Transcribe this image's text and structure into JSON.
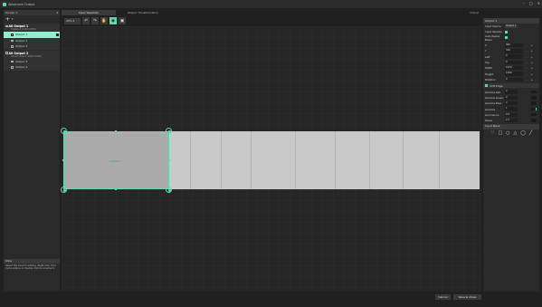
{
  "window": {
    "title": "Advanced Output",
    "controls": [
      "–",
      "□",
      "✕"
    ]
  },
  "left_panel": {
    "screen_label": "Screen 1",
    "add_icon": "+",
    "add_arrow": "▾",
    "groups": [
      {
        "name": "All Output 1",
        "sub": "Display 2 (1920×1080)",
        "outputs": [
          "Output 1",
          "Output 2",
          "Output 3"
        ],
        "selected": 0
      },
      {
        "name": "All Output 2",
        "sub": "Virtual Output (1920×1080)",
        "outputs": [
          "Output 3",
          "Output 4"
        ],
        "selected": -1
      }
    ]
  },
  "info": {
    "title": "Slice",
    "text": "Select the slice for editing. Right click it for more options or double click to rename it."
  },
  "tabs": {
    "input": "Input Selection",
    "output": "Output Transformation",
    "corner": "Virtual"
  },
  "toolbar": {
    "zoom": "29%",
    "zoom_arrow": "▾"
  },
  "canvas": {
    "selected_label": "Output 1",
    "columns": 8
  },
  "right_panel": {
    "title": "Output 1",
    "input_source_label": "Input Source",
    "input_source_value": "Output 1",
    "rows_check": [
      "Input Opacity",
      "Auto Resize Bezel"
    ],
    "numeric": [
      {
        "label": "X",
        "value": "960"
      },
      {
        "label": "Y",
        "value": "540"
      },
      {
        "label": "Left",
        "value": "0"
      },
      {
        "label": "Top",
        "value": "0"
      },
      {
        "label": "Width",
        "value": "1920"
      },
      {
        "label": "Height",
        "value": "1080"
      },
      {
        "label": "Rotation",
        "value": "0"
      }
    ],
    "soft_edge_label": "Soft Edge",
    "sliders": [
      {
        "label": "Gamma Red",
        "value": "2"
      },
      {
        "label": "Gamma Green",
        "value": "2"
      },
      {
        "label": "Gamma Blue",
        "value": "2"
      },
      {
        "label": "Gamma",
        "value": "1"
      },
      {
        "label": "Luminance",
        "value": "0.5"
      },
      {
        "label": "Power",
        "value": "2.5"
      }
    ],
    "masks_title": "Input Mask",
    "mask_icons": [
      "♡",
      "□",
      "○",
      "△",
      "◯",
      "╱"
    ]
  },
  "footer": {
    "cancel": "Cancel",
    "save": "Save & Close"
  },
  "colors": {
    "accent": "#63d6b4",
    "selected_row": "#8ef0d0",
    "panel": "#2a2a2a",
    "bg": "#202020"
  }
}
